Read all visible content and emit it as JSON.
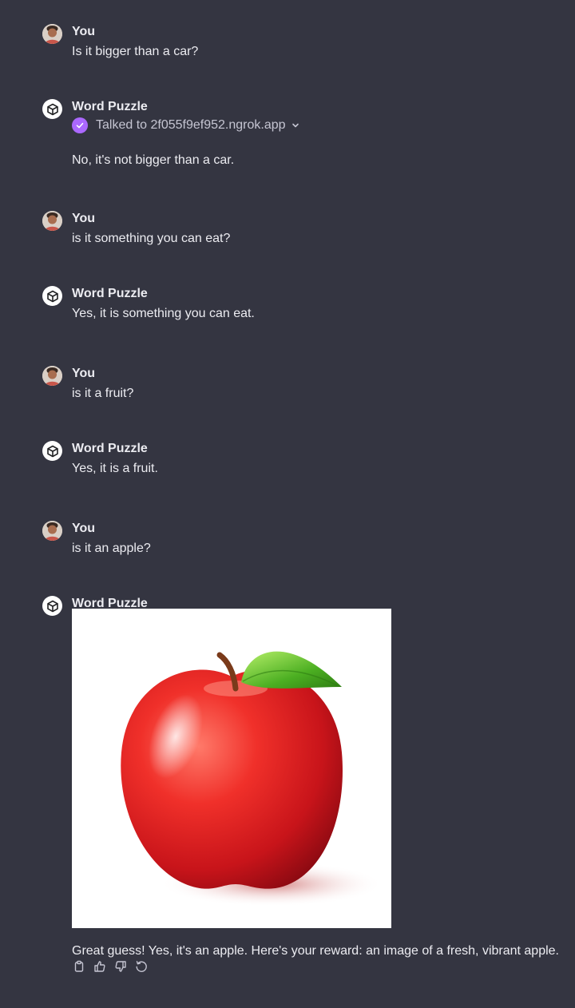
{
  "messages": [
    {
      "author": "You",
      "text": "Is it bigger than a car?"
    },
    {
      "author": "Word Puzzle",
      "tool_status": "Talked to 2f055f9ef952.ngrok.app",
      "text": "No, it's not bigger than a car."
    },
    {
      "author": "You",
      "text": "is it something you can eat?"
    },
    {
      "author": "Word Puzzle",
      "text": "Yes, it is something you can eat."
    },
    {
      "author": "You",
      "text": "is it a fruit?"
    },
    {
      "author": "Word Puzzle",
      "text": "Yes, it is a fruit."
    },
    {
      "author": "You",
      "text": "is it an apple?"
    },
    {
      "author": "Word Puzzle",
      "image": "apple-image",
      "text": "Great guess! Yes, it's an apple. Here's your reward: an image of a fresh, vibrant apple."
    }
  ],
  "colors": {
    "background": "#343541",
    "text": "#ececf1",
    "muted": "#c5c5d2",
    "tool_check": "#ab68ff"
  },
  "icons": {
    "tool_status": "check-circle-icon",
    "expand": "chevron-down-icon",
    "actions": [
      "copy-icon",
      "thumbs-up-icon",
      "thumbs-down-icon",
      "regenerate-icon"
    ]
  }
}
